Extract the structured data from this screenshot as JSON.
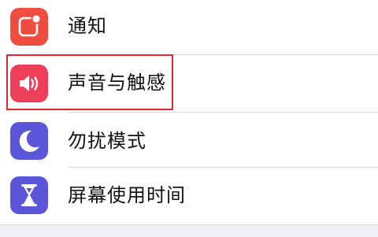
{
  "settings": {
    "items": [
      {
        "label": "通知",
        "icon": "notifications-icon",
        "color": "#ee4d3f"
      },
      {
        "label": "声音与触感",
        "icon": "speaker-icon",
        "color": "#ed3f5a"
      },
      {
        "label": "勿扰模式",
        "icon": "moon-icon",
        "color": "#5a55d9"
      },
      {
        "label": "屏幕使用时间",
        "icon": "hourglass-icon",
        "color": "#5a55d9"
      }
    ]
  },
  "annotation": {
    "highlight_color": "#e0262f",
    "highlighted_item": "声音与触感"
  }
}
